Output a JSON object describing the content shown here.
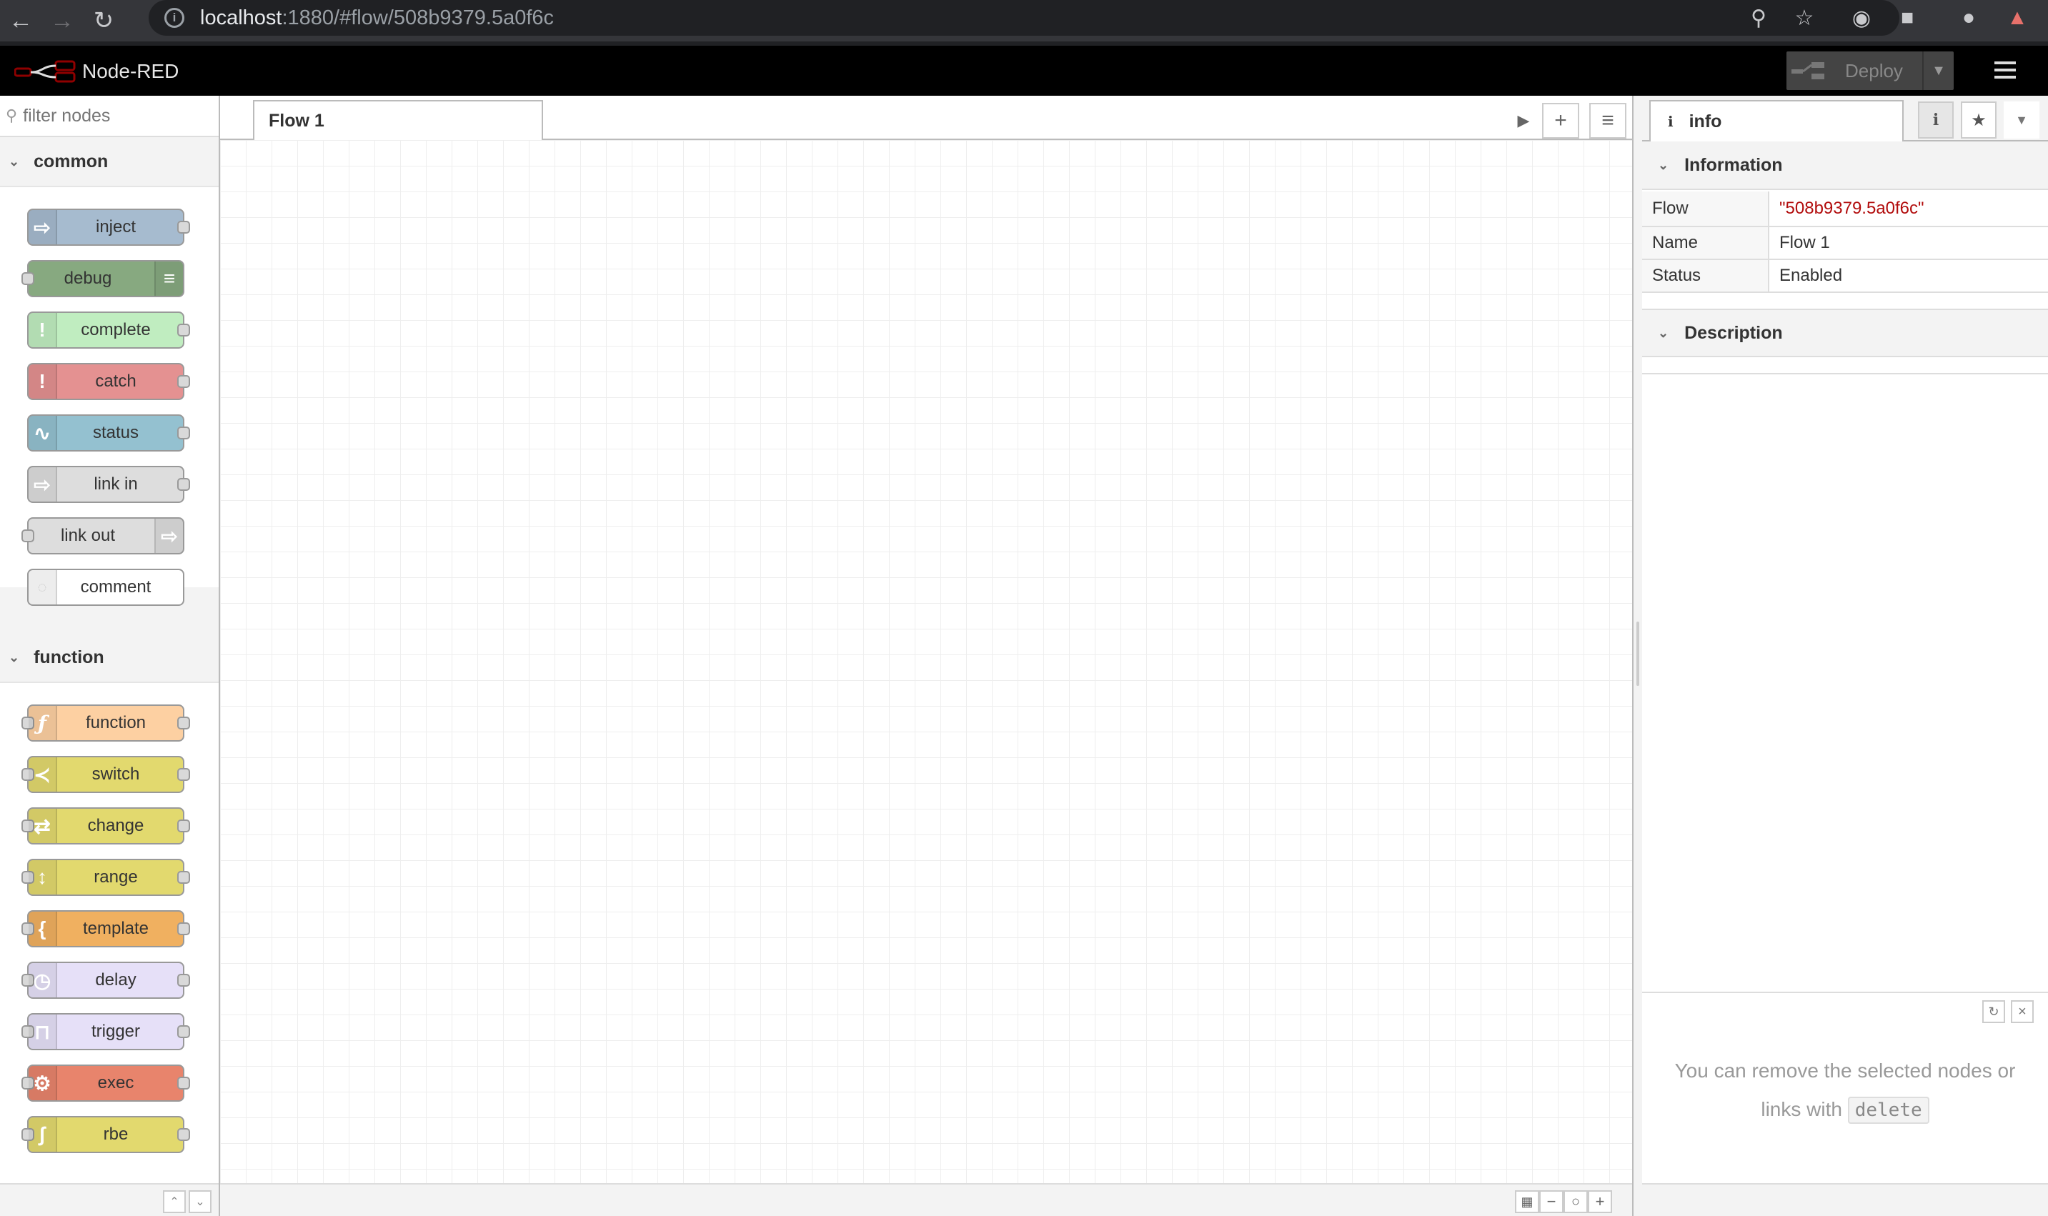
{
  "browser": {
    "url_host": "localhost",
    "url_rest": ":1880/#flow/508b9379.5a0f6c"
  },
  "header": {
    "title": "Node-RED",
    "deploy_label": "Deploy"
  },
  "palette": {
    "filter_placeholder": "filter nodes",
    "categories": [
      {
        "name": "common",
        "nodes": [
          {
            "label": "inject",
            "color": "#a6bbcf",
            "icon": "arrow-icon"
          },
          {
            "label": "debug",
            "color": "#87a980",
            "icon": "list-icon"
          },
          {
            "label": "complete",
            "color": "#c0edc0",
            "icon": "exclamation-icon"
          },
          {
            "label": "catch",
            "color": "#e49191",
            "icon": "exclamation-icon"
          },
          {
            "label": "status",
            "color": "#94c1d0",
            "icon": "pulse-icon"
          },
          {
            "label": "link in",
            "color": "#dddddd",
            "icon": "link-in-icon"
          },
          {
            "label": "link out",
            "color": "#dddddd",
            "icon": "link-out-icon"
          },
          {
            "label": "comment",
            "color": "#ffffff",
            "icon": "comment-icon"
          }
        ]
      },
      {
        "name": "function",
        "nodes": [
          {
            "label": "function",
            "color": "#fdd0a2",
            "icon": "function-icon"
          },
          {
            "label": "switch",
            "color": "#e2d96e",
            "icon": "switch-icon"
          },
          {
            "label": "change",
            "color": "#e2d96e",
            "icon": "shuffle-icon"
          },
          {
            "label": "range",
            "color": "#e2d96e",
            "icon": "range-icon"
          },
          {
            "label": "template",
            "color": "#f0b060",
            "icon": "brace-icon"
          },
          {
            "label": "delay",
            "color": "#e6e0f8",
            "icon": "timer-icon"
          },
          {
            "label": "trigger",
            "color": "#e6e0f8",
            "icon": "trigger-icon"
          },
          {
            "label": "exec",
            "color": "#e8846c",
            "icon": "cog-icon"
          },
          {
            "label": "rbe",
            "color": "#e2d96e",
            "icon": "rbe-icon"
          }
        ]
      }
    ]
  },
  "workspace": {
    "tabs": [
      {
        "label": "Flow 1"
      }
    ]
  },
  "sidebar": {
    "tab_label": "info",
    "information_heading": "Information",
    "properties": [
      {
        "key": "Flow",
        "value": "\"508b9379.5a0f6c\""
      },
      {
        "key": "Name",
        "value": "Flow 1"
      },
      {
        "key": "Status",
        "value": "Enabled"
      }
    ],
    "description_heading": "Description",
    "help_text_before": "You can remove the selected nodes or links with",
    "help_key": "delete"
  }
}
